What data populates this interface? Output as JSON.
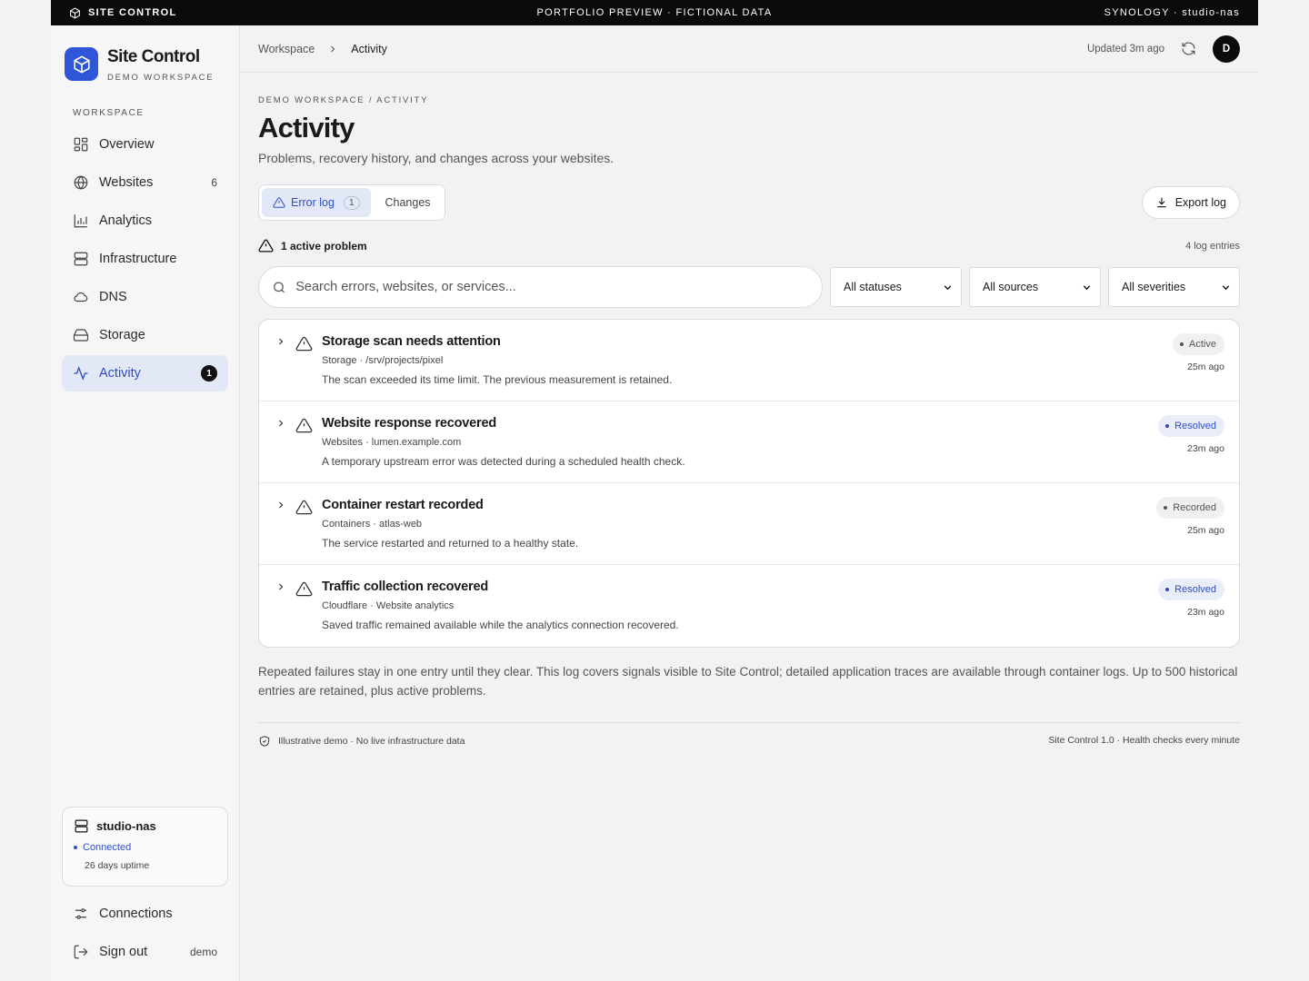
{
  "topbar": {
    "app_name": "SITE CONTROL",
    "center": "PORTFOLIO PREVIEW · FICTIONAL DATA",
    "right": "SYNOLOGY · studio-nas"
  },
  "sidebar": {
    "brand_name": "Site Control",
    "brand_sub": "DEMO WORKSPACE",
    "section_heading": "WORKSPACE",
    "items": [
      {
        "label": "Overview",
        "icon": "grid-icon"
      },
      {
        "label": "Websites",
        "icon": "globe-icon",
        "count": "6"
      },
      {
        "label": "Analytics",
        "icon": "bar-chart-icon"
      },
      {
        "label": "Infrastructure",
        "icon": "server-icon"
      },
      {
        "label": "DNS",
        "icon": "cloud-icon"
      },
      {
        "label": "Storage",
        "icon": "hard-drive-icon"
      },
      {
        "label": "Activity",
        "icon": "activity-icon",
        "badge": "1",
        "active": true
      }
    ],
    "host": {
      "name": "studio-nas",
      "status": "Connected",
      "uptime": "26 days uptime"
    },
    "connections_label": "Connections",
    "signout_label": "Sign out",
    "user": "demo"
  },
  "header": {
    "breadcrumb": [
      "Workspace",
      "Activity"
    ],
    "updated": "Updated 3m ago",
    "avatar_initial": "D"
  },
  "page": {
    "eyebrow": "DEMO WORKSPACE / ACTIVITY",
    "title": "Activity",
    "subtitle": "Problems, recovery history, and changes across your websites."
  },
  "tabs": [
    {
      "label": "Error log",
      "count": "1",
      "active": true
    },
    {
      "label": "Changes"
    }
  ],
  "export_label": "Export log",
  "summary": {
    "active_problems": "1 active problem",
    "entries": "4 log entries"
  },
  "filters": {
    "search_placeholder": "Search errors, websites, or services...",
    "status": "All statuses",
    "source": "All sources",
    "severity": "All severities"
  },
  "log_entries": [
    {
      "title": "Storage scan needs attention",
      "source": "Storage · /srv/projects/pixel",
      "description": "The scan exceeded its time limit. The previous measurement is retained.",
      "status": "Active",
      "status_style": "neutral",
      "time": "25m ago"
    },
    {
      "title": "Website response recovered",
      "source": "Websites · lumen.example.com",
      "description": "A temporary upstream error was detected during a scheduled health check.",
      "status": "Resolved",
      "status_style": "blue",
      "time": "23m ago"
    },
    {
      "title": "Container restart recorded",
      "source": "Containers · atlas-web",
      "description": "The service restarted and returned to a healthy state.",
      "status": "Recorded",
      "status_style": "neutral",
      "time": "25m ago"
    },
    {
      "title": "Traffic collection recovered",
      "source": "Cloudflare · Website analytics",
      "description": "Saved traffic remained available while the analytics connection recovered.",
      "status": "Resolved",
      "status_style": "blue",
      "time": "23m ago"
    }
  ],
  "note": "Repeated failures stay in one entry until they clear. This log covers signals visible to Site Control; detailed application traces are available through container logs. Up to 500 historical entries are retained, plus active problems.",
  "footer": {
    "left": "Illustrative demo · No live infrastructure data",
    "right": "Site Control 1.0 · Health checks every minute"
  },
  "colors": {
    "accent": "#2f56d9",
    "accent_text": "#2f4ec4",
    "active_bg": "#e3e8f6",
    "topbar_bg": "#0b0b0b",
    "page_bg": "#f2f2f4"
  }
}
